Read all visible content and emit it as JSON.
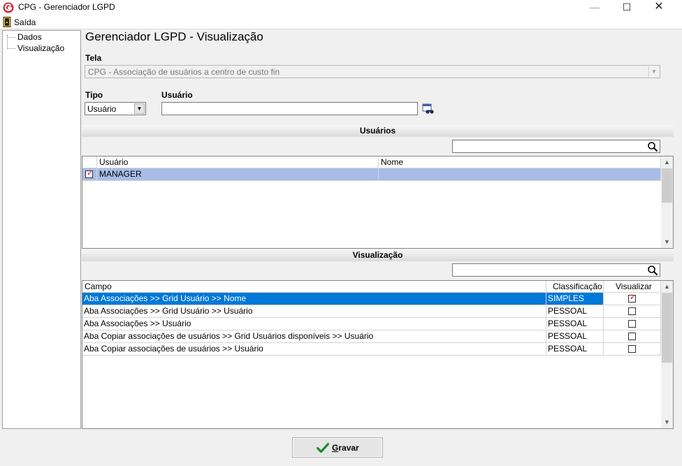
{
  "window": {
    "title": "CPG - Gerenciador LGPD",
    "min": "—",
    "max": "☐",
    "close": "✕"
  },
  "menu": {
    "items": [
      {
        "label": "Saída",
        "icon": "exit-door-icon"
      }
    ]
  },
  "tree": {
    "items": [
      {
        "label": "Dados"
      },
      {
        "label": "Visualização"
      }
    ]
  },
  "page": {
    "heading": "Gerenciador LGPD - Visualização"
  },
  "form": {
    "tela_label": "Tela",
    "tela_value": "CPG - Associação de usuários a centro de custo fin",
    "tipo_label": "Tipo",
    "tipo_value": "Usuário",
    "usuario_label": "Usuário",
    "usuario_value": ""
  },
  "usuarios": {
    "title": "Usuários",
    "search_value": "",
    "columns": [
      "Usuário",
      "Nome"
    ],
    "rows": [
      {
        "checked": true,
        "usuario": "MANAGER",
        "nome": ""
      }
    ]
  },
  "visualizacao": {
    "title": "Visualização",
    "search_value": "",
    "columns": [
      "Campo",
      "Classificação",
      "Visualizar"
    ],
    "rows": [
      {
        "campo": "Aba Associações >> Grid Usuário >> Nome",
        "classificacao": "SIMPLES",
        "visualizar": true
      },
      {
        "campo": "Aba Associações >> Grid Usuário >> Usuário",
        "classificacao": "PESSOAL",
        "visualizar": false
      },
      {
        "campo": "Aba Associações >> Usuário",
        "classificacao": "PESSOAL",
        "visualizar": false
      },
      {
        "campo": "Aba Copiar associações de usuários >> Grid Usuários disponíveis >> Usuário",
        "classificacao": "PESSOAL",
        "visualizar": false
      },
      {
        "campo": "Aba Copiar associações de usuários >> Usuário",
        "classificacao": "PESSOAL",
        "visualizar": false
      }
    ]
  },
  "actions": {
    "save_label": "Gravar",
    "save_icon": "green-check-icon"
  },
  "colors": {
    "selection_blue": "#0078d7",
    "selection_lilac": "#a9bce8",
    "check_red": "#cc0000",
    "check_green": "#1e8c2a",
    "logo_red": "#d22630"
  }
}
